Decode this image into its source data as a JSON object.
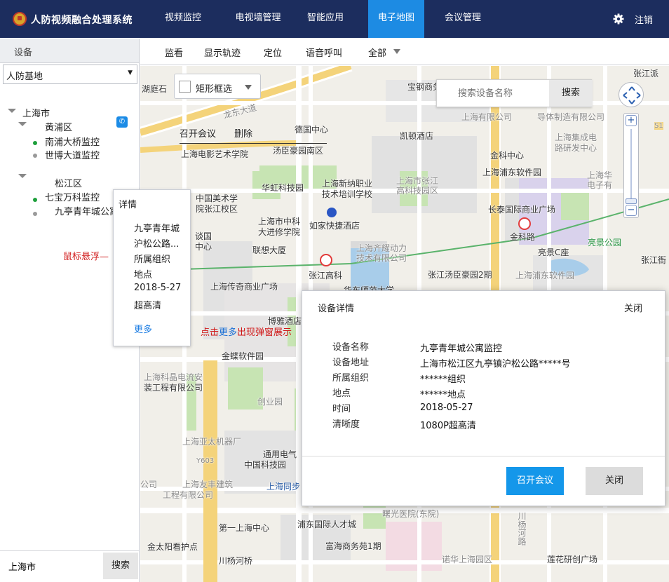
{
  "header": {
    "app_title": "人防视频融合处理系统",
    "nav": [
      "视频监控",
      "电视墙管理",
      "智能应用",
      "电子地图",
      "会议管理"
    ],
    "active_nav": "电子地图",
    "logout": "注销"
  },
  "left": {
    "title": "设备",
    "org_select": "人防基地",
    "tree": {
      "root": "上海市",
      "district1": "黄浦区",
      "d1_items": [
        "南浦大桥监控",
        "世博大道监控"
      ],
      "district2": "松江区",
      "d2_items": [
        "七宝万科监控",
        "九亭青年城公寓"
      ]
    },
    "search_value": "上海市",
    "search_button": "搜索"
  },
  "toolbar": {
    "items": [
      "监看",
      "显示轨迹",
      "定位",
      "语音呼叫",
      "全部"
    ]
  },
  "map": {
    "rect_select": "矩形框选",
    "actions": [
      "召开会议",
      "删除"
    ],
    "search_placeholder": "搜索设备名称",
    "search_button": "搜索",
    "labels": [
      "湖庭石",
      "宝钢商务",
      "张江派",
      "龙东大道",
      "上海有限公司",
      "导体制造有限公司",
      "上海集成电",
      "路研发中心",
      "德国中心",
      "凯顿酒店",
      "汤臣豪园南区",
      "上海电影艺术学院",
      "金科中心",
      "上海浦东软件园",
      "上海华",
      "电子有",
      "华虹科技园",
      "上海新纳职业",
      "技术培训学校",
      "上海市张江",
      "高科技园区",
      "中国美术学",
      "院张江校区",
      "长泰国际商业广场",
      "上海市中科",
      "大进修学院",
      "如家快捷酒店",
      "金科路",
      "联想大厦",
      "上海齐耀动力",
      "技术有限公司",
      "亮景C座",
      "亮景公园",
      "张江高科",
      "张江汤臣豪园2期",
      "上海传奇商业广场",
      "华东师范大学",
      "上海浦东软件园",
      "张江衙",
      "博雅酒店",
      "金蝶软件园",
      "上海科晶电流安",
      "装工程有限公司",
      "创业园",
      "上海亚太机器厂",
      "通用电气",
      "中国科技园",
      "上海友丰建筑",
      "工程有限公司",
      "公司",
      "上海同步",
      "第一上海中心",
      "浦东国际人才城",
      "曙光医院(东院)",
      "富海商务苑1期",
      "金太阳看护点",
      "川杨河桥",
      "诺华上海园区",
      "莲花研创广场",
      "谈国",
      "中心",
      "川杨河路",
      "Y603",
      "S1"
    ]
  },
  "popup": {
    "title": "详情",
    "lines": [
      "九亭青年城",
      "沪松公路...",
      "所属组织",
      "地点",
      "2018-5-27",
      "超高清"
    ],
    "more": "更多"
  },
  "annotations": {
    "hover": "鼠标悬浮",
    "click_pre": "点击",
    "click_link": "更多",
    "click_post": "出现弹窗展示"
  },
  "modal": {
    "title": "设备详情",
    "close_text": "关闭",
    "fields": [
      {
        "label": "设备名称",
        "value": "九亭青年城公寓监控"
      },
      {
        "label": "设备地址",
        "value": "上海市松江区九亭镇沪松公路*****号"
      },
      {
        "label": "所属组织",
        "value": "******组织"
      },
      {
        "label": "地点",
        "value": "******地点"
      },
      {
        "label": "时间",
        "value": "2018-05-27"
      },
      {
        "label": "清晰度",
        "value": "1080P超高清"
      }
    ],
    "primary_button": "召开会议",
    "secondary_button": "关闭"
  },
  "colors": {
    "header_bg": "#1c2d5e",
    "nav_active": "#1d8be3",
    "primary_button": "#1497ea",
    "link": "#1a7ce3",
    "annotation": "#d01818"
  }
}
